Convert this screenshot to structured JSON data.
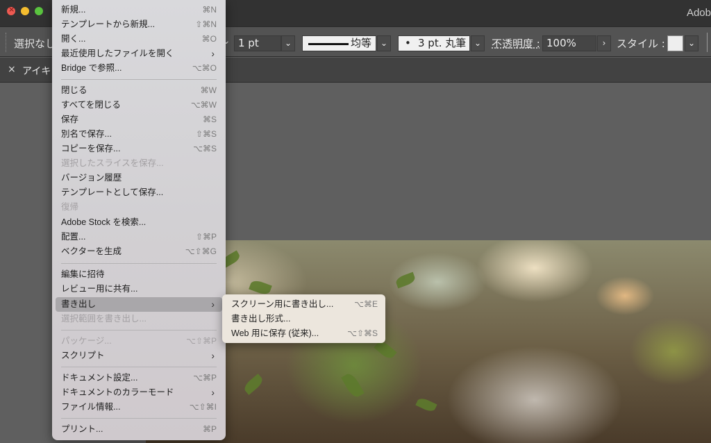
{
  "window": {
    "app_title": "Adob"
  },
  "control_bar": {
    "selection_label": "選択なし",
    "stroke_weight": "1 pt",
    "profile_label": "均等",
    "brush_dot": "•",
    "brush_label": "3 pt. 丸筆",
    "opacity_label": "不透明度 :",
    "opacity_value": "100%",
    "style_label": "スタイル :"
  },
  "tab": {
    "close_glyph": "×",
    "label": "アイキ"
  },
  "file_menu": {
    "items": [
      {
        "label": "新規...",
        "shortcut": "⌘N"
      },
      {
        "label": "テンプレートから新規...",
        "shortcut": "⇧⌘N"
      },
      {
        "label": "開く...",
        "shortcut": "⌘O"
      },
      {
        "label": "最近使用したファイルを開く",
        "shortcut": ""
      },
      {
        "label": "Bridge で参照...",
        "shortcut": "⌥⌘O"
      },
      {
        "label": "閉じる",
        "shortcut": "⌘W"
      },
      {
        "label": "すべてを閉じる",
        "shortcut": "⌥⌘W"
      },
      {
        "label": "保存",
        "shortcut": "⌘S"
      },
      {
        "label": "別名で保存...",
        "shortcut": "⇧⌘S"
      },
      {
        "label": "コピーを保存...",
        "shortcut": "⌥⌘S"
      },
      {
        "label": "選択したスライスを保存...",
        "shortcut": ""
      },
      {
        "label": "バージョン履歴",
        "shortcut": ""
      },
      {
        "label": "テンプレートとして保存...",
        "shortcut": ""
      },
      {
        "label": "復帰",
        "shortcut": ""
      },
      {
        "label": "Adobe Stock を検索...",
        "shortcut": ""
      },
      {
        "label": "配置...",
        "shortcut": "⇧⌘P"
      },
      {
        "label": "ベクターを生成",
        "shortcut": "⌥⇧⌘G"
      },
      {
        "label": "編集に招待",
        "shortcut": ""
      },
      {
        "label": "レビュー用に共有...",
        "shortcut": ""
      },
      {
        "label": "書き出し",
        "shortcut": ""
      },
      {
        "label": "選択範囲を書き出し...",
        "shortcut": ""
      },
      {
        "label": "パッケージ...",
        "shortcut": "⌥⇧⌘P"
      },
      {
        "label": "スクリプト",
        "shortcut": ""
      },
      {
        "label": "ドキュメント設定...",
        "shortcut": "⌥⌘P"
      },
      {
        "label": "ドキュメントのカラーモード",
        "shortcut": ""
      },
      {
        "label": "ファイル情報...",
        "shortcut": "⌥⇧⌘I"
      },
      {
        "label": "プリント...",
        "shortcut": "⌘P"
      }
    ],
    "submenu_arrow": "›"
  },
  "export_submenu": {
    "items": [
      {
        "label": "スクリーン用に書き出し...",
        "shortcut": "⌥⌘E"
      },
      {
        "label": "書き出し形式...",
        "shortcut": ""
      },
      {
        "label": "Web 用に保存 (従来)...",
        "shortcut": "⌥⇧⌘S"
      }
    ]
  }
}
